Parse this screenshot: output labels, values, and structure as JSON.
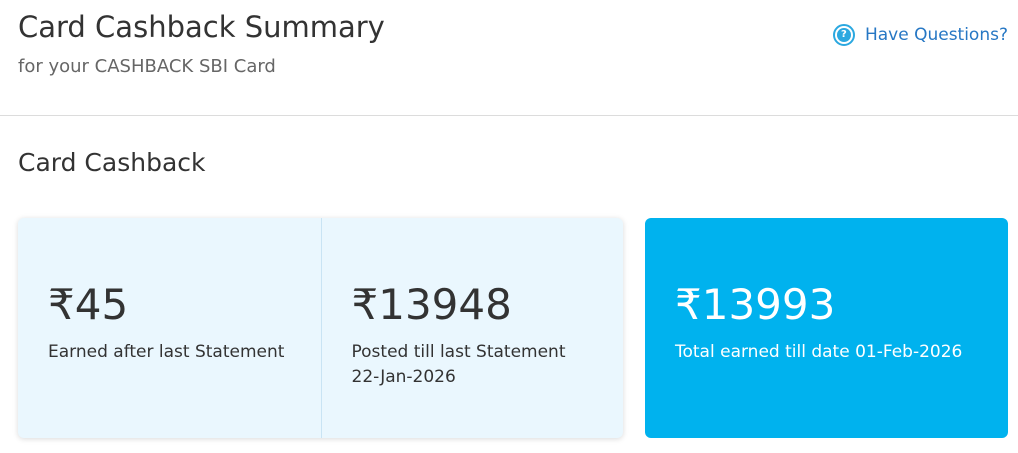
{
  "header": {
    "title": "Card Cashback Summary",
    "subtitle": "for your CASHBACK SBI Card",
    "help_label": "Have Questions?",
    "help_icon": "question-circle-icon"
  },
  "section": {
    "title": "Card Cashback"
  },
  "cards": {
    "earned": {
      "amount": "₹45",
      "label": "Earned after last Statement"
    },
    "posted": {
      "amount": "₹13948",
      "label": "Posted till last Statement",
      "date": "22-Jan-2026"
    },
    "total": {
      "amount": "₹13993",
      "label": "Total earned till date 01-Feb-2026"
    }
  },
  "colors": {
    "accent": "#00b2ee",
    "link": "#2677c4",
    "light_card": "#eaf7fe"
  }
}
